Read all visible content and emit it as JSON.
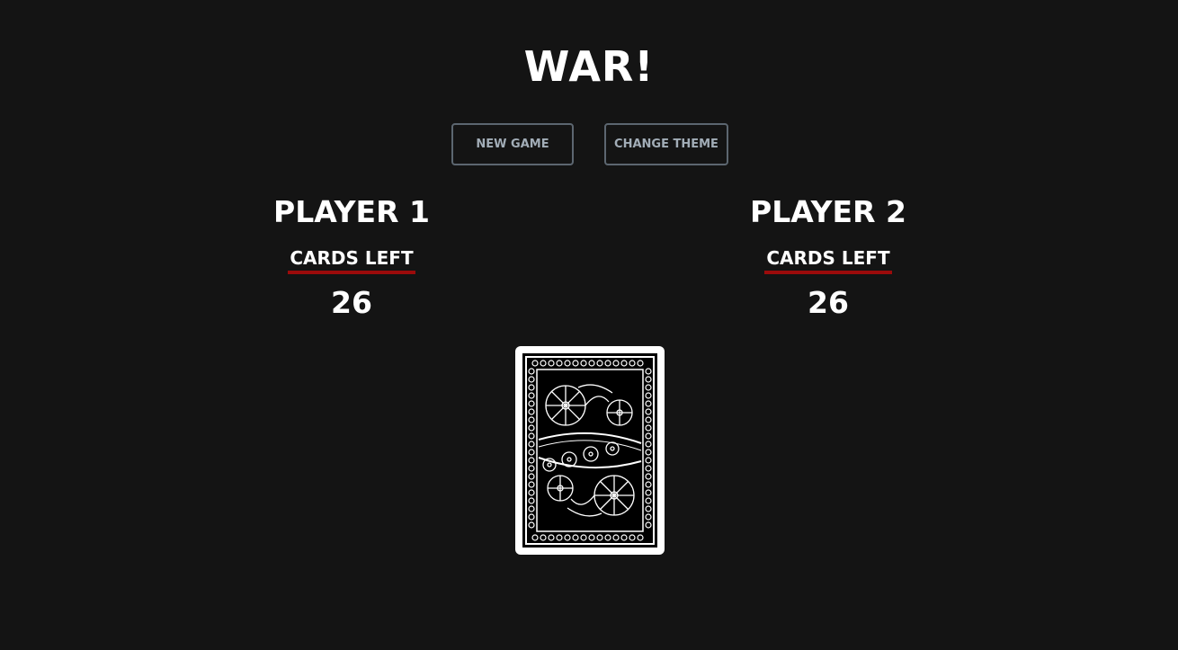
{
  "header": {
    "title": "WAR!"
  },
  "controls": {
    "new_game_label": "NEW GAME",
    "change_theme_label": "CHANGE THEME"
  },
  "players": [
    {
      "name": "PLAYER 1",
      "cards_left_label": "CARDS LEFT",
      "cards_left": "26"
    },
    {
      "name": "PLAYER 2",
      "cards_left_label": "CARDS LEFT",
      "cards_left": "26"
    }
  ],
  "deck": {
    "icon": "card-back-icon"
  },
  "colors": {
    "background": "#141414",
    "accent_underline": "#9b0b0b",
    "button_border": "#5c6670",
    "button_text": "#a2adb7"
  }
}
